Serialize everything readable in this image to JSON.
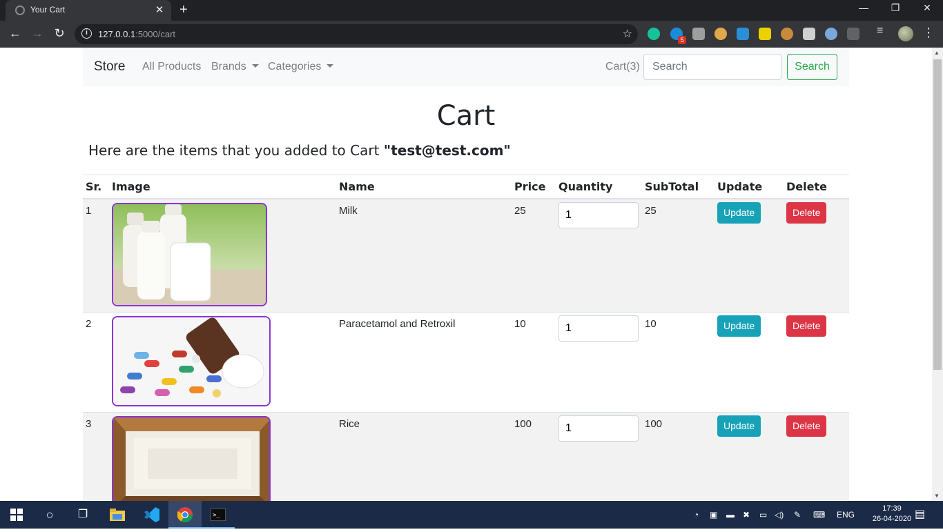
{
  "browser": {
    "tab_title": "Your Cart",
    "tab_close": "✕",
    "new_tab": "+",
    "url_host": "127.0.0.1",
    "url_path": ":5000/cart",
    "window_controls": {
      "minimize": "—",
      "restore": "❐",
      "close": "✕"
    },
    "extension_badge": "5"
  },
  "navbar": {
    "brand": "Store",
    "links": {
      "all_products": "All Products",
      "brands": "Brands",
      "categories": "Categories"
    },
    "cart": "Cart(3)",
    "search_placeholder": "Search",
    "search_button": "Search"
  },
  "page": {
    "title": "Cart",
    "intro_prefix": "Here are the items that you added to Cart ",
    "intro_user": "\"test@test.com\""
  },
  "table": {
    "headers": {
      "sr": "Sr.",
      "image": "Image",
      "name": "Name",
      "price": "Price",
      "quantity": "Quantity",
      "subtotal": "SubTotal",
      "update": "Update",
      "delete": "Delete"
    },
    "rows": [
      {
        "sr": "1",
        "name": "Milk",
        "price": "25",
        "quantity": "1",
        "subtotal": "25",
        "update": "Update",
        "delete": "Delete"
      },
      {
        "sr": "2",
        "name": "Paracetamol and Retroxil",
        "price": "10",
        "quantity": "1",
        "subtotal": "10",
        "update": "Update",
        "delete": "Delete"
      },
      {
        "sr": "3",
        "name": "Rice",
        "price": "100",
        "quantity": "1",
        "subtotal": "100",
        "update": "Update",
        "delete": "Delete"
      }
    ]
  },
  "taskbar": {
    "language": "ENG",
    "time": "17:39",
    "date": "26-04-2020"
  },
  "colors": {
    "navbar_bg": "#f8f9fa",
    "search_green": "#28a745",
    "update_teal": "#17a2b8",
    "delete_red": "#dc3545",
    "image_border": "#8a34d6",
    "taskbar": "#1b2a47"
  }
}
